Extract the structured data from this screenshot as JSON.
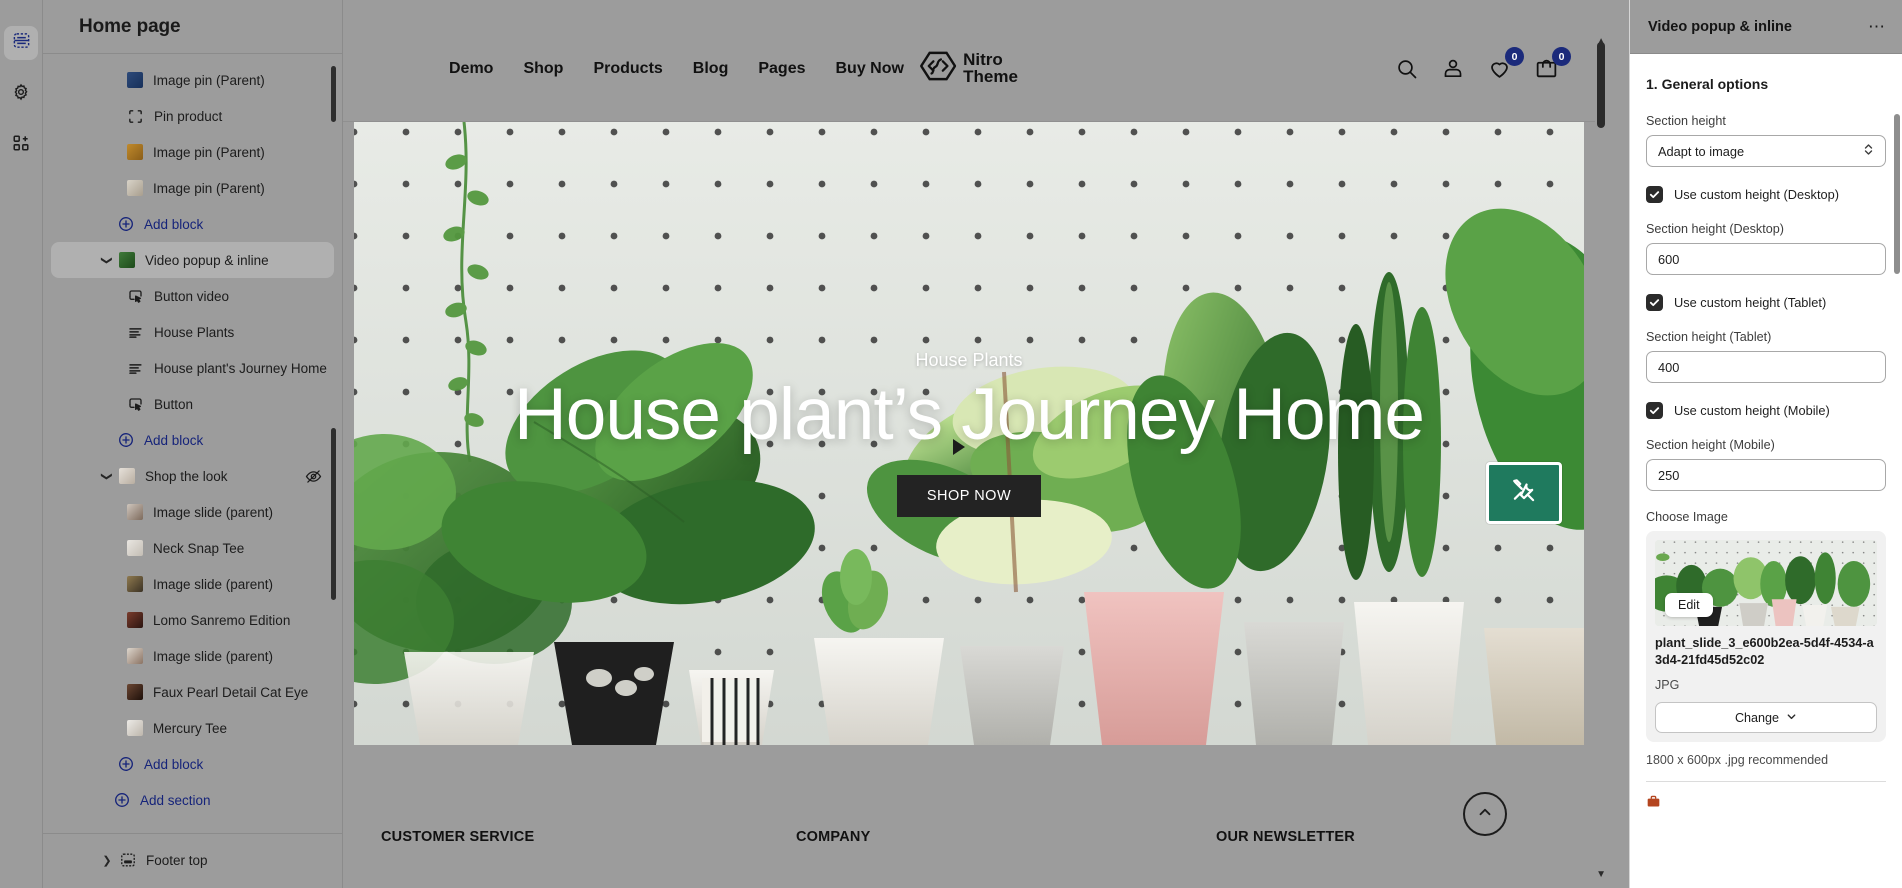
{
  "rail": {
    "items": [
      {
        "name": "sections-icon",
        "title": "Sections"
      },
      {
        "name": "gear-icon",
        "title": "Settings"
      },
      {
        "name": "apps-add-icon",
        "title": "Apps"
      }
    ]
  },
  "sidebar": {
    "title": "Home page",
    "tree": [
      {
        "label": "Image pin (Parent)",
        "icon": "image-thumb",
        "level": 2,
        "kind": "thumb",
        "color1": "#2d4a7a",
        "color2": "#17305a"
      },
      {
        "label": "Pin product",
        "icon": "pin-product-icon",
        "level": 2,
        "kind": "glyph"
      },
      {
        "label": "Image pin (Parent)",
        "icon": "image-thumb",
        "level": 2,
        "kind": "thumb",
        "color1": "#c08a2c",
        "color2": "#8a5d18"
      },
      {
        "label": "Image pin (Parent)",
        "icon": "image-thumb",
        "level": 2,
        "kind": "thumb",
        "color1": "#d8d3c8",
        "color2": "#a89e8e"
      },
      {
        "label": "Add block",
        "icon": "plus-circle-icon",
        "level": 2,
        "kind": "add-block"
      },
      {
        "label": "Video popup & inline",
        "icon": "image-thumb",
        "level": 1,
        "kind": "section",
        "selected": true,
        "expanded": true,
        "color1": "#3f7a3a",
        "color2": "#1d4a1a"
      },
      {
        "label": "Button video",
        "icon": "button-icon",
        "level": 2,
        "kind": "glyph"
      },
      {
        "label": "House Plants",
        "icon": "text-lines-icon",
        "level": 2,
        "kind": "glyph"
      },
      {
        "label": "House plant's Journey Home",
        "icon": "text-lines-icon",
        "level": 2,
        "kind": "glyph"
      },
      {
        "label": "Button",
        "icon": "button-icon",
        "level": 2,
        "kind": "glyph"
      },
      {
        "label": "Add block",
        "icon": "plus-circle-icon",
        "level": 2,
        "kind": "add-block"
      },
      {
        "label": "Shop the look",
        "icon": "image-thumb",
        "level": 1,
        "kind": "section",
        "expanded": true,
        "hidden": true,
        "color1": "#e6e1da",
        "color2": "#b8ada0"
      },
      {
        "label": "Image slide (parent)",
        "icon": "image-thumb",
        "level": 2,
        "kind": "thumb",
        "color1": "#cfc6bd",
        "color2": "#7d6a5c"
      },
      {
        "label": "Neck Snap Tee",
        "icon": "image-thumb",
        "level": 2,
        "kind": "thumb",
        "color1": "#e9e6e1",
        "color2": "#c3bdb4"
      },
      {
        "label": "Image slide (parent)",
        "icon": "image-thumb",
        "level": 2,
        "kind": "thumb",
        "color1": "#8f7a4f",
        "color2": "#3b3224"
      },
      {
        "label": "Lomo Sanremo Edition",
        "icon": "image-thumb",
        "level": 2,
        "kind": "thumb",
        "color1": "#7a3c2c",
        "color2": "#2b1410"
      },
      {
        "label": "Image slide (parent)",
        "icon": "image-thumb",
        "level": 2,
        "kind": "thumb",
        "color1": "#ddd6cd",
        "color2": "#8b7363"
      },
      {
        "label": "Faux Pearl Detail Cat Eye",
        "icon": "image-thumb",
        "level": 2,
        "kind": "thumb",
        "color1": "#6b4632",
        "color2": "#1e100a"
      },
      {
        "label": "Mercury Tee",
        "icon": "image-thumb",
        "level": 2,
        "kind": "thumb",
        "color1": "#eceae6",
        "color2": "#bdb6ac"
      },
      {
        "label": "Add block",
        "icon": "plus-circle-icon",
        "level": 2,
        "kind": "add-block"
      },
      {
        "label": "Add section",
        "icon": "plus-circle-icon",
        "level": 1,
        "kind": "add-section"
      }
    ],
    "footer_group": {
      "label": "Footer top",
      "icon": "footer-icon"
    }
  },
  "preview": {
    "nav": [
      "Demo",
      "Shop",
      "Products",
      "Blog",
      "Pages",
      "Buy Now"
    ],
    "brand": {
      "line1": "Nitro",
      "line2": "Theme"
    },
    "header_icons": [
      {
        "name": "search-icon",
        "badge": null
      },
      {
        "name": "account-icon",
        "badge": null
      },
      {
        "name": "wishlist-heart-icon",
        "badge": "0"
      },
      {
        "name": "cart-bag-icon",
        "badge": "0"
      }
    ],
    "hero": {
      "eyebrow": "House Plants",
      "title": "House plant’s Journey Home",
      "cta": "SHOP NOW",
      "section_badge_icon": "tools-icon"
    },
    "footer": {
      "columns": [
        "CUSTOMER SERVICE",
        "COMPANY",
        "OUR NEWSLETTER"
      ]
    },
    "back_to_top_icon": "chevron-up-icon"
  },
  "rpanel": {
    "title": "Video popup & inline",
    "more_icon": "ellipsis-icon",
    "section_title": "1. General options",
    "fields": {
      "section_height_label": "Section height",
      "section_height_value": "Adapt to image",
      "use_custom_desktop": "Use custom height (Desktop)",
      "section_height_desktop_label": "Section height (Desktop)",
      "section_height_desktop_value": "600",
      "use_custom_tablet": "Use custom height (Tablet)",
      "section_height_tablet_label": "Section height (Tablet)",
      "section_height_tablet_value": "400",
      "use_custom_mobile": "Use custom height (Mobile)",
      "section_height_mobile_label": "Section height (Mobile)",
      "section_height_mobile_value": "250",
      "choose_image_label": "Choose Image",
      "edit_button": "Edit",
      "image_name": "plant_slide_3_e600b2ea-5d4f-4534-a3d4-21fd45d52c02",
      "image_type": "JPG",
      "change_button": "Change",
      "image_hint": "1800 x 600px .jpg recommended"
    }
  },
  "colors": {
    "accent_link": "#16247a",
    "badge": "#1b2a7b",
    "section_badge_green": "#1f7a5e",
    "chrome_gray": "#9c9c9c"
  }
}
